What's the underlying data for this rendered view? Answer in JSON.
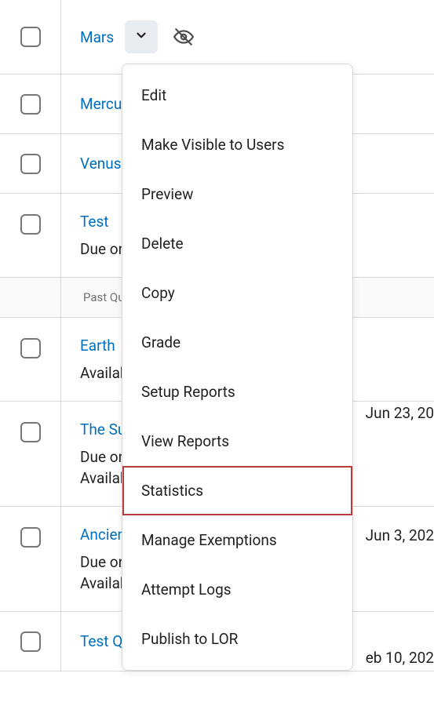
{
  "rows": [
    {
      "title": "Mars",
      "has_dropdown": true,
      "has_hidden_icon": true
    },
    {
      "title": "Mercury"
    },
    {
      "title": "Venus"
    },
    {
      "title": "Test",
      "due": "Due on"
    },
    {
      "section_header": "Past Quizzes"
    },
    {
      "title": "Earth",
      "availability": "Available on",
      "right_date": "Jun 23, 20"
    },
    {
      "title": "The Sun",
      "due": "Due on",
      "availability": "Available on",
      "right_date": "Jun 3, 202"
    },
    {
      "title": "Ancient",
      "due": "Due on",
      "availability": "Available on",
      "right_date": "eb 10, 202"
    },
    {
      "title": "Test Quiz"
    }
  ],
  "menu": {
    "items": [
      "Edit",
      "Make Visible to Users",
      "Preview",
      "Delete",
      "Copy",
      "Grade",
      "Setup Reports",
      "View Reports",
      "Statistics",
      "Manage Exemptions",
      "Attempt Logs",
      "Publish to LOR"
    ],
    "highlighted_index": 8
  },
  "row_dates_top": {
    "5": 516,
    "6": 672,
    "7": 828
  }
}
